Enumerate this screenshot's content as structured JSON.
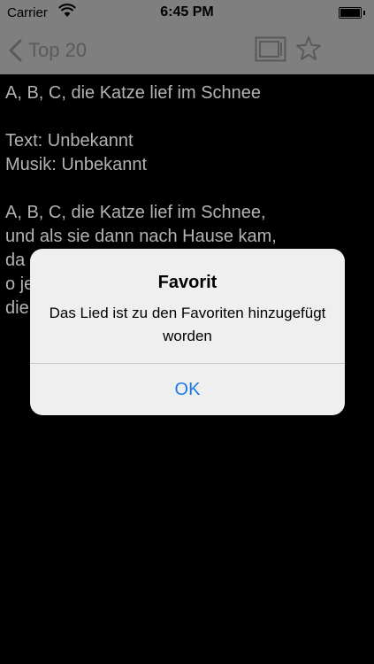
{
  "status_bar": {
    "carrier": "Carrier",
    "time": "6:45 PM"
  },
  "nav": {
    "back_label": "Top 20",
    "icons": [
      "chevron-left-icon",
      "tv-icon",
      "star-icon"
    ]
  },
  "song": {
    "title": "A, B, C, die Katze lief im Schnee",
    "lyricist": "Text: Unbekannt",
    "composer": "Musik: Unbekannt",
    "lyrics": [
      "A, B, C, die Katze lief im Schnee,",
      "und als sie dann nach Hause kam,",
      "da",
      "o je",
      "die"
    ]
  },
  "alert": {
    "title": "Favorit",
    "message": "Das Lied ist zu den Favoriten hinzugefügt worden",
    "ok_label": "OK"
  },
  "colors": {
    "background": "#000000",
    "dimmed_bar": "#7f7f7f",
    "alert_background": "#efefef",
    "alert_button": "#1a7ae6",
    "text": "#b3b3b3"
  }
}
